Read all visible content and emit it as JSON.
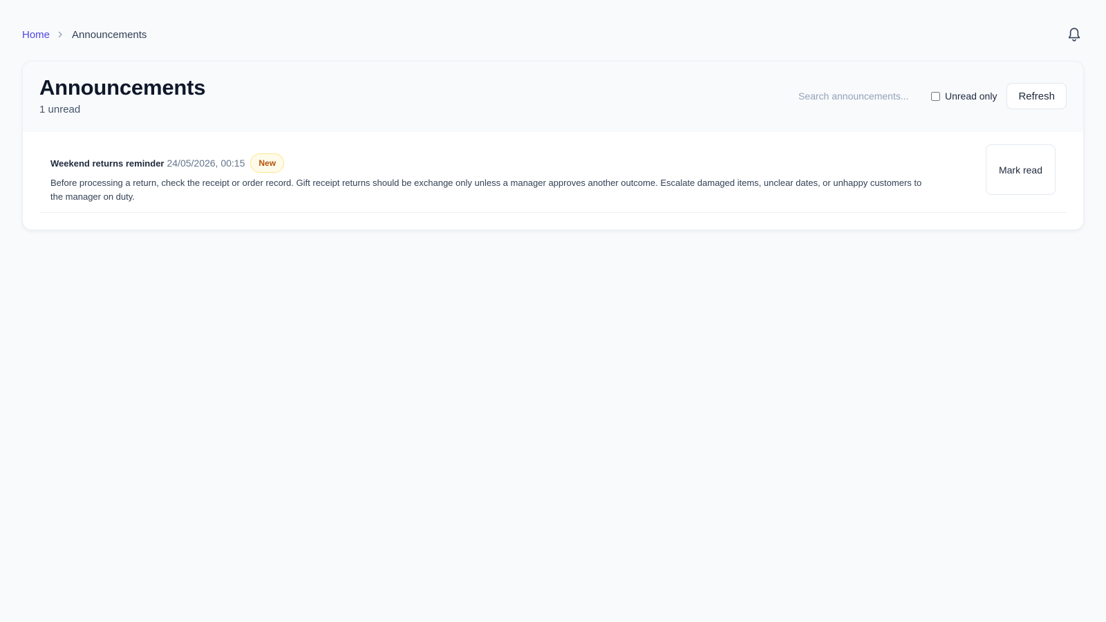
{
  "breadcrumb": {
    "home_label": "Home",
    "current_label": "Announcements",
    "separator_icon": "chevron-right-icon"
  },
  "header": {
    "notification_icon": "bell-icon"
  },
  "page": {
    "title": "Announcements",
    "unread_summary": "1 unread"
  },
  "controls": {
    "search_placeholder": "Search announcements...",
    "search_value": "",
    "unread_only_label": "Unread only",
    "unread_only_checked": false,
    "refresh_label": "Refresh"
  },
  "announcements": [
    {
      "title": "Weekend returns reminder",
      "timestamp": "24/05/2026, 00:15",
      "badge": "New",
      "body": "Before processing a return, check the receipt or order record. Gift receipt returns should be exchange only unless a manager approves another outcome. Escalate damaged items, unclear dates, or unhappy customers to the manager on duty.",
      "action_label": "Mark read"
    }
  ],
  "colors": {
    "accent": "#4f46e5",
    "badge_bg": "#fffbeb",
    "badge_border": "#fde68a",
    "badge_text": "#b45309"
  }
}
